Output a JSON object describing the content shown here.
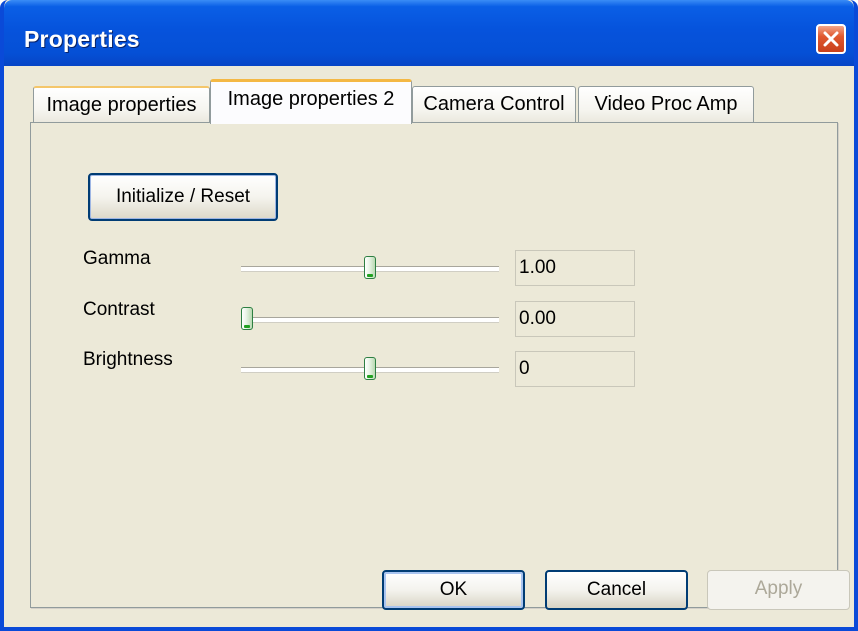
{
  "window": {
    "title": "Properties"
  },
  "tabs": [
    {
      "label": "Image properties",
      "active": false
    },
    {
      "label": "Image properties 2",
      "active": true
    },
    {
      "label": "Camera Control",
      "active": false
    },
    {
      "label": "Video Proc Amp",
      "active": false
    }
  ],
  "panel": {
    "reset_button": "Initialize / Reset",
    "controls": [
      {
        "label": "Gamma",
        "value": "1.00",
        "slider_level": 0.5
      },
      {
        "label": "Contrast",
        "value": "0.00",
        "slider_level": 0.0
      },
      {
        "label": "Brightness",
        "value": "0",
        "slider_level": 0.5
      }
    ]
  },
  "footer": {
    "ok": "OK",
    "cancel": "Cancel",
    "apply": "Apply"
  },
  "colors": {
    "titlebar": "#0653dc",
    "close": "#e0582f",
    "active_tab_accent": "#f4b844",
    "face": "#ece9d8",
    "thumb_accent": "#21a121"
  },
  "icons": {
    "close": "close-x-icon"
  }
}
